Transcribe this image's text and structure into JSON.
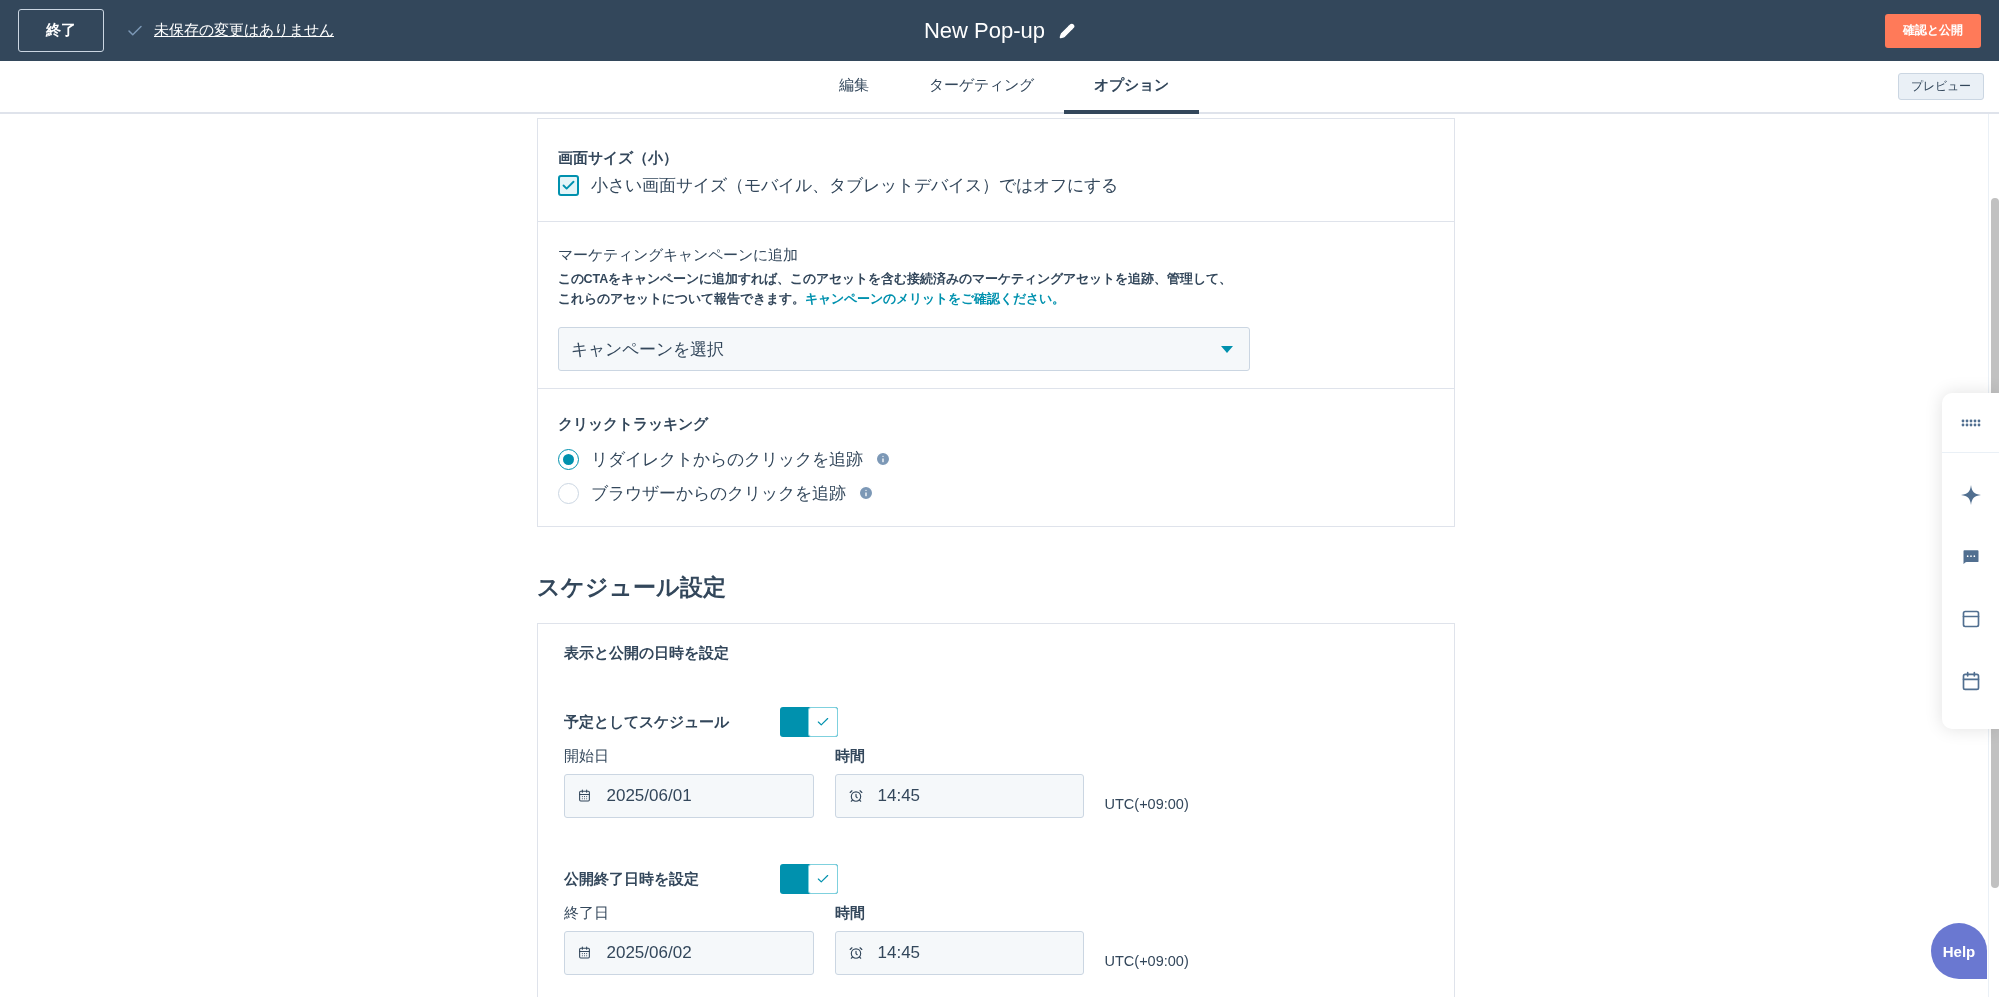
{
  "header": {
    "exit_button": "終了",
    "save_status": "未保存の変更はありません",
    "title": "New Pop-up",
    "publish_button": "確認と公開"
  },
  "tabs": [
    {
      "label": "編集",
      "selected": false
    },
    {
      "label": "ターゲティング",
      "selected": false
    },
    {
      "label": "オプション",
      "selected": true
    }
  ],
  "preview_button": "プレビュー",
  "options": {
    "screen_size": {
      "heading": "画面サイズ（小）",
      "checkbox": {
        "label": "小さい画面サイズ（モバイル、タブレットデバイス）ではオフにする",
        "checked": true
      }
    },
    "campaign": {
      "heading": "マーケティングキャンペーンに追加",
      "description": "このCTAをキャンペーンに追加すれば、このアセットを含む接続済みのマーケティングアセットを追跡、管理して、これらのアセットについて報告できます。",
      "link": "キャンペーンのメリットをご確認ください。",
      "placeholder": "キャンペーンを選択"
    },
    "click_tracking": {
      "heading": "クリックトラッキング",
      "options": [
        {
          "label": "リダイレクトからのクリックを追跡",
          "selected": true
        },
        {
          "label": "ブラウザーからのクリックを追跡",
          "selected": false
        }
      ]
    }
  },
  "schedule": {
    "title": "スケジュール設定",
    "card_heading": "表示と公開の日時を設定",
    "rows": [
      {
        "toggle_label": "予定としてスケジュール",
        "on": true,
        "date_label": "開始日",
        "date": "2025/06/01",
        "time_label": "時間",
        "time": "14:45",
        "timezone": "UTC(+09:00)"
      },
      {
        "toggle_label": "公開終了日時を設定",
        "on": true,
        "date_label": "終了日",
        "date": "2025/06/02",
        "time_label": "時間",
        "time": "14:45",
        "timezone": "UTC(+09:00)"
      }
    ]
  },
  "help_button": "Help"
}
